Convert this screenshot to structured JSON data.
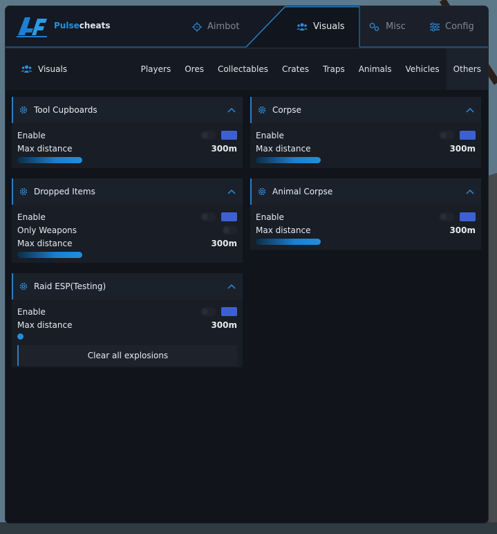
{
  "brand": {
    "part1": "Pulse",
    "part2": "cheats"
  },
  "top_tabs": [
    {
      "label": "Aimbot",
      "icon": "crosshair-icon"
    },
    {
      "label": "Visuals",
      "icon": "users-icon"
    },
    {
      "label": "Misc",
      "icon": "gears-icon"
    },
    {
      "label": "Config",
      "icon": "sliders-icon"
    }
  ],
  "subnav": {
    "title": "Visuals",
    "tabs": [
      "Players",
      "Ores",
      "Collectables",
      "Crates",
      "Traps",
      "Animals",
      "Vehicles",
      "Others"
    ],
    "active": "Others"
  },
  "panels": {
    "tool_cupboards": {
      "title": "Tool Cupboards",
      "enable": "Enable",
      "max_distance": "Max distance",
      "distance_value": "300m",
      "distance_level": 0.4
    },
    "corpse": {
      "title": "Corpse",
      "enable": "Enable",
      "max_distance": "Max distance",
      "distance_value": "300m",
      "distance_level": 0.4
    },
    "dropped_items": {
      "title": "Dropped Items",
      "enable": "Enable",
      "only_weapons": "Only Weapons",
      "max_distance": "Max distance",
      "distance_value": "300m",
      "distance_level": 0.4
    },
    "animal_corpse": {
      "title": "Animal Corpse",
      "enable": "Enable",
      "max_distance": "Max distance",
      "distance_value": "300m",
      "distance_level": 0.4
    },
    "raid_esp": {
      "title": "Raid ESP(Testing)",
      "enable": "Enable",
      "max_distance": "Max distance",
      "distance_value": "300m",
      "distance_level": 0.0,
      "clear_button": "Clear all explosions"
    }
  },
  "colors": {
    "accent": "#2b7fc4",
    "toggle_on": "#3e5fd3",
    "window_bg": "#11141b"
  }
}
